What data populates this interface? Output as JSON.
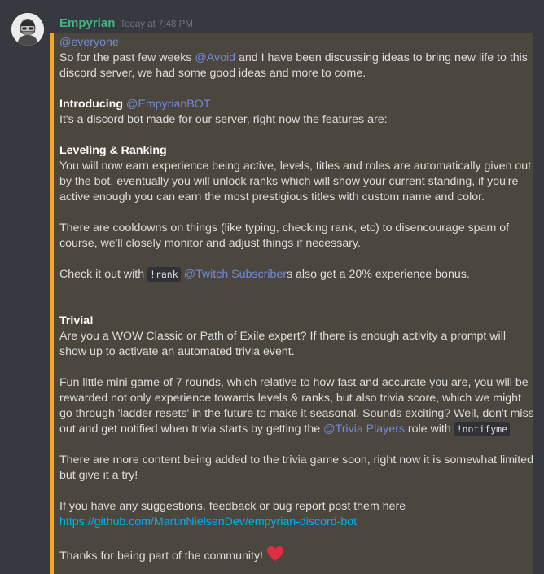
{
  "author": {
    "name": "Empyrian",
    "timestamp": "Today at 7:48 PM"
  },
  "message": {
    "everyone": "@everyone",
    "intro_pre": "So for the past few weeks ",
    "intro_mention": "@Avoid",
    "intro_post": " and I have been discussing ideas to bring new life to this discord server, we had some good ideas and more to come.",
    "introducing_label": "Introducing",
    "bot_mention": "@EmpyrianBOT",
    "bot_desc": "It's a discord bot made for our server, right now the features are:",
    "leveling_heading": "Leveling & Ranking",
    "leveling_text": "You will now earn experience being active, levels, titles and roles are automatically given out by the bot, eventually you will unlock ranks which will show your current standing, if you're active enough you can earn the most prestigious titles with custom name and color.",
    "cooldown_text": "There are cooldowns on things (like typing, checking rank, etc) to disencourage spam of course, we'll closely monitor and adjust things if necessary.",
    "checkout_pre": "Check it out with ",
    "rank_command": "!rank",
    "twitch_mention": "@Twitch Subscriber",
    "checkout_post": "s also get a 20% experience bonus.",
    "trivia_heading": "Trivia!",
    "trivia_text": "Are you a WOW Classic or Path of Exile expert? If there is enough activity a prompt will show up to activate an automated trivia event.",
    "fun_pre": "Fun little mini game of 7 rounds, which relative to how fast and accurate you are, you will be rewarded not only experience towards levels & ranks, but also trivia score, which we might go through 'ladder resets' in the future to make it seasonal. Sounds exciting? Well, don't miss out and get notified when trivia starts by getting the ",
    "trivia_players_mention": "@Trivia Players",
    "fun_mid": " role with ",
    "notifyme_command": "!notifyme",
    "more_content_text": "There are more content being added to the trivia game soon, right now it is somewhat limited but give it a try!",
    "suggestions_text": "If you have any suggestions, feedback or bug report post them here",
    "github_link": "https://github.com/MartinNielsenDev/empyrian-discord-bot",
    "thanks_text": "Thanks for being part of the community!"
  },
  "icons": {
    "avatar": "hooded-figure-avatar",
    "heart": "heart-emoji"
  },
  "colors": {
    "background": "#36393f",
    "highlight_bg": "#4b473e",
    "highlight_border": "#faa61a",
    "username": "#43b581",
    "mention": "#7289da",
    "link": "#00b0f4",
    "heart": "#dd2e44"
  }
}
